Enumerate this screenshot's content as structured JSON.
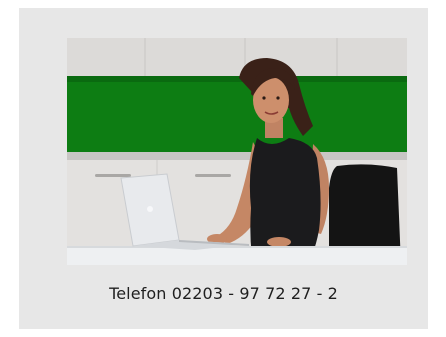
{
  "contact_card": {
    "phone_label": "Telefon 02203 - 97 72 27 - 2"
  },
  "photo": {
    "description_icon": "person-at-laptop-photo",
    "colors": {
      "background": "#e7e7e7",
      "green_backsplash": "#0e7a12",
      "top_cabinets": "#d8d6d4",
      "lower_cabinets": "#e2e0de",
      "desk": "#eef0f2",
      "laptop": "#e9ebee",
      "dress": "#1b1b1d",
      "skin": "#c98c6a",
      "hair": "#3a2118",
      "chair": "#151515"
    }
  }
}
